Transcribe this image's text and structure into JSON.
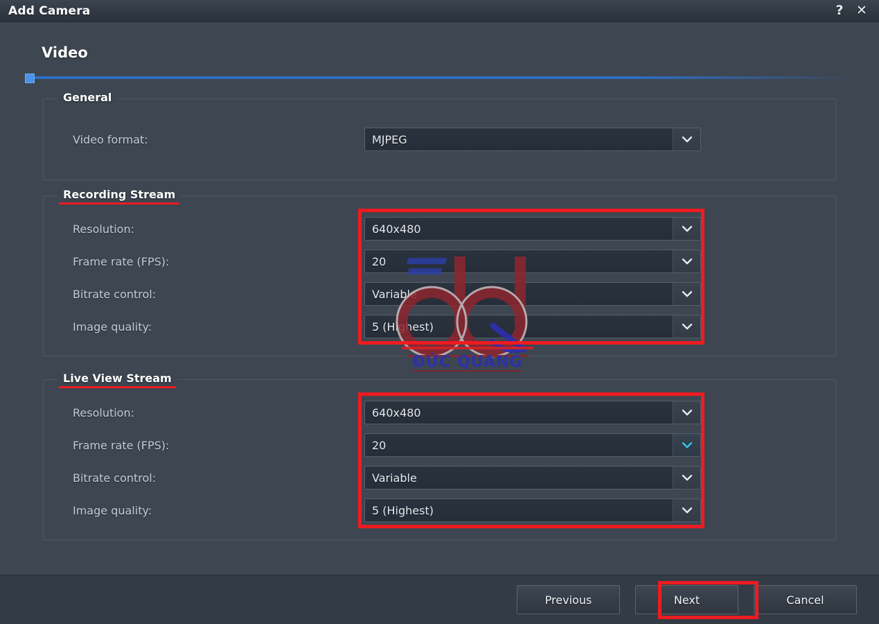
{
  "window": {
    "title": "Add Camera",
    "help_icon": "question-mark-icon",
    "close_icon": "close-icon"
  },
  "wizard": {
    "step_title": "Video",
    "progress_percent": 3
  },
  "sections": {
    "general": {
      "legend": "General",
      "underlined": false,
      "rows": [
        {
          "label": "Video format:",
          "value": "MJPEG",
          "focused": false
        }
      ]
    },
    "recording_stream": {
      "legend": "Recording Stream",
      "underlined": true,
      "highlighted": true,
      "rows": [
        {
          "label": "Resolution:",
          "value": "640x480",
          "focused": false
        },
        {
          "label": "Frame rate (FPS):",
          "value": "20",
          "focused": false
        },
        {
          "label": "Bitrate control:",
          "value": "Variable",
          "focused": false
        },
        {
          "label": "Image quality:",
          "value": "5 (Highest)",
          "focused": false
        }
      ]
    },
    "live_view_stream": {
      "legend": "Live View Stream",
      "underlined": true,
      "highlighted": true,
      "rows": [
        {
          "label": "Resolution:",
          "value": "640x480",
          "focused": false
        },
        {
          "label": "Frame rate (FPS):",
          "value": "20",
          "focused": true
        },
        {
          "label": "Bitrate control:",
          "value": "Variable",
          "focused": false
        },
        {
          "label": "Image quality:",
          "value": "5 (Highest)",
          "focused": false
        }
      ]
    }
  },
  "footer": {
    "previous_label": "Previous",
    "next_label": "Next",
    "cancel_label": "Cancel",
    "next_highlighted": true
  },
  "watermark": {
    "logo": "dq-logo",
    "text": "ĐỨC QUANG",
    "logo_color": "#8e2630",
    "text_color": "#2b2fb4"
  },
  "colors": {
    "window_background": "#3d4651",
    "titlebar": "#333b45",
    "footer": "#333b45",
    "combo_background": "#2a323d",
    "accent_blue": "#2f6fc4",
    "annotation_red": "#ee1b20",
    "label_text": "#c7ccd3",
    "value_text": "#e7ebf0",
    "focus_cyan": "#35c6e6"
  }
}
